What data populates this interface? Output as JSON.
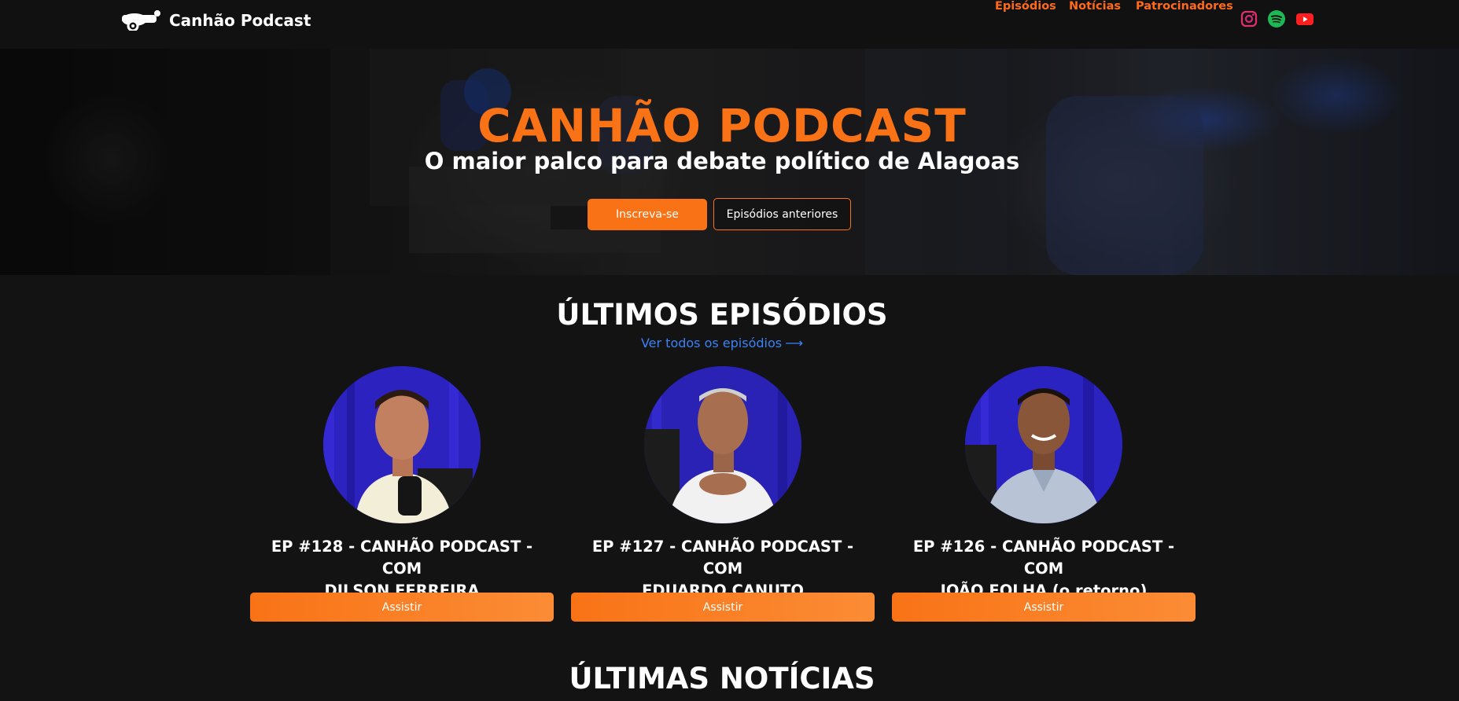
{
  "nav": {
    "brand_name": "Canhão Podcast",
    "links": [
      {
        "label": "Episódios"
      },
      {
        "label": "Notícias"
      },
      {
        "label": "Patrocinadores"
      }
    ],
    "social_icons": [
      "instagram-icon",
      "spotify-icon",
      "youtube-icon"
    ]
  },
  "hero": {
    "title": "CANHÃO PODCAST",
    "subtitle": "O maior palco para debate político de Alagoas",
    "subscribe_label": "Inscreva-se",
    "previous_label": "Episódios anteriores"
  },
  "episodes_section": {
    "title": "ÚLTIMOS EPISÓDIOS",
    "see_all_label": "Ver todos os episódios",
    "episodes": [
      {
        "title_line1": "EP #128 - CANHÃO PODCAST - COM",
        "title_line2": "DILSON FERREIRA",
        "button": "Assistir"
      },
      {
        "title_line1": "EP #127 - CANHÃO PODCAST - COM",
        "title_line2": "EDUARDO CANUTO",
        "button": "Assistir"
      },
      {
        "title_line1": "EP #126 - CANHÃO PODCAST - COM",
        "title_line2": "JOÃO FOLHA (o retorno)",
        "button": "Assistir"
      }
    ]
  },
  "news_section": {
    "title": "ÚLTIMAS NOTÍCIAS"
  },
  "colors": {
    "accent": "#f97316",
    "link_blue": "#3b82f6",
    "background": "#131313"
  }
}
